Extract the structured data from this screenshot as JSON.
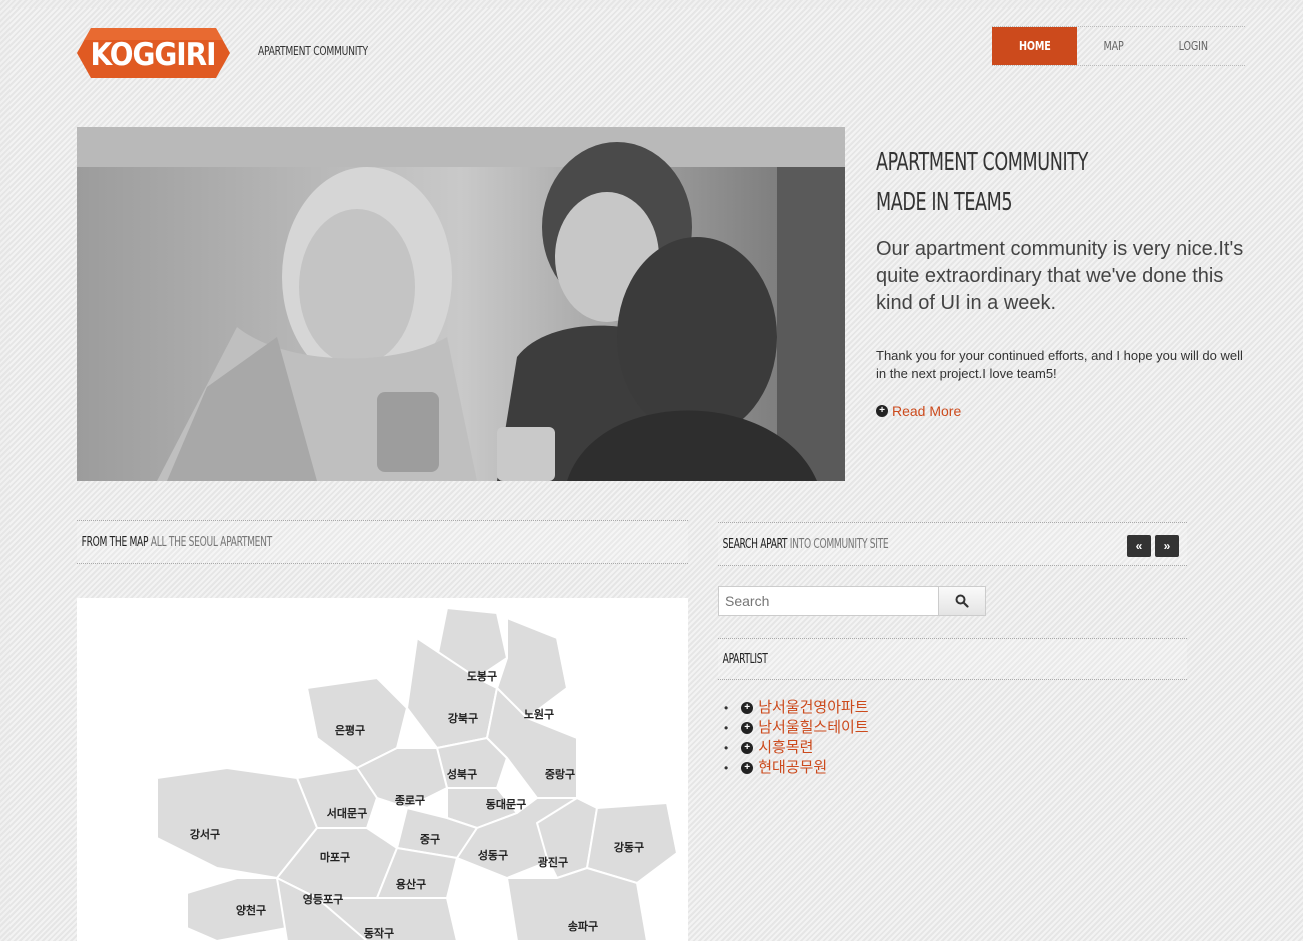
{
  "header": {
    "logo_text": "KOGGIRI",
    "tagline": "APARTMENT COMMUNITY",
    "nav": [
      {
        "label": "HOME",
        "active": true
      },
      {
        "label": "MAP",
        "active": false
      },
      {
        "label": "LOGIN",
        "active": false
      }
    ]
  },
  "hero": {
    "title_line1": "APARTMENT COMMUNITY",
    "title_line2": "MADE IN TEAM5",
    "lead": "Our apartment community is very nice.It's quite extraordinary that we've done this kind of UI in a week.",
    "small": "Thank you for your continued efforts, and I hope you will do well in the next project.I love team5!",
    "read_more": "Read More"
  },
  "map_section": {
    "title_bold": "FROM THE MAP",
    "title_light": "ALL THE SEOUL APARTMENT",
    "districts": [
      "도봉구",
      "노원구",
      "강북구",
      "은평구",
      "성북구",
      "중랑구",
      "종로구",
      "동대문구",
      "서대문구",
      "중구",
      "강서구",
      "마포구",
      "성동구",
      "광진구",
      "강동구",
      "용산구",
      "양천구",
      "영등포구",
      "동작구",
      "송파구"
    ]
  },
  "search_section": {
    "title_bold": "SEARCH APART",
    "title_light": "INTO COMMUNITY SITE",
    "prev": "«",
    "next": "»",
    "placeholder": "Search"
  },
  "apart_list": {
    "title": "APARTLIST",
    "items": [
      "남서울건영아파트",
      "남서울힐스테이트",
      "시흥목련",
      "현대공무원"
    ]
  },
  "colors": {
    "accent": "#cc4a1c",
    "background": "#eaeaea"
  }
}
